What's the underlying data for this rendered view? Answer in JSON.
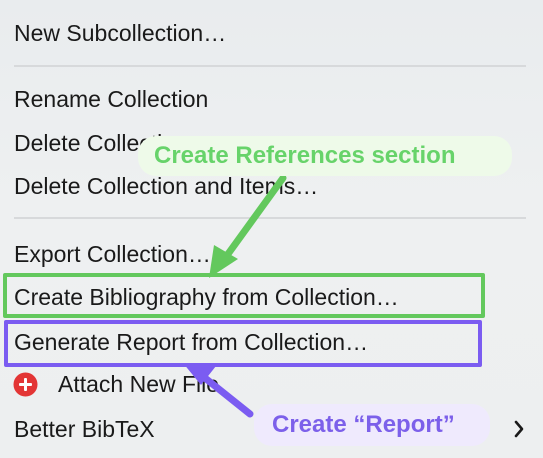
{
  "menu": {
    "items": [
      {
        "label": "New Subcollection…"
      },
      {
        "label": "Rename Collection"
      },
      {
        "label": "Delete Collection…"
      },
      {
        "label": "Delete Collection and Items…"
      },
      {
        "label": "Export Collection…"
      },
      {
        "label": "Create Bibliography from Collection…"
      },
      {
        "label": "Generate Report from Collection…"
      },
      {
        "label": "Attach New File"
      },
      {
        "label": "Better BibTeX"
      }
    ]
  },
  "annotations": {
    "green_callout": "Create  References section",
    "purple_callout": "Create “Report”"
  },
  "colors": {
    "green": "#63c85d",
    "purple": "#7b5cf1",
    "red_icon": "#e33535"
  },
  "icons": {
    "attach": "plus-circle-icon",
    "submenu": "chevron-right-icon"
  }
}
